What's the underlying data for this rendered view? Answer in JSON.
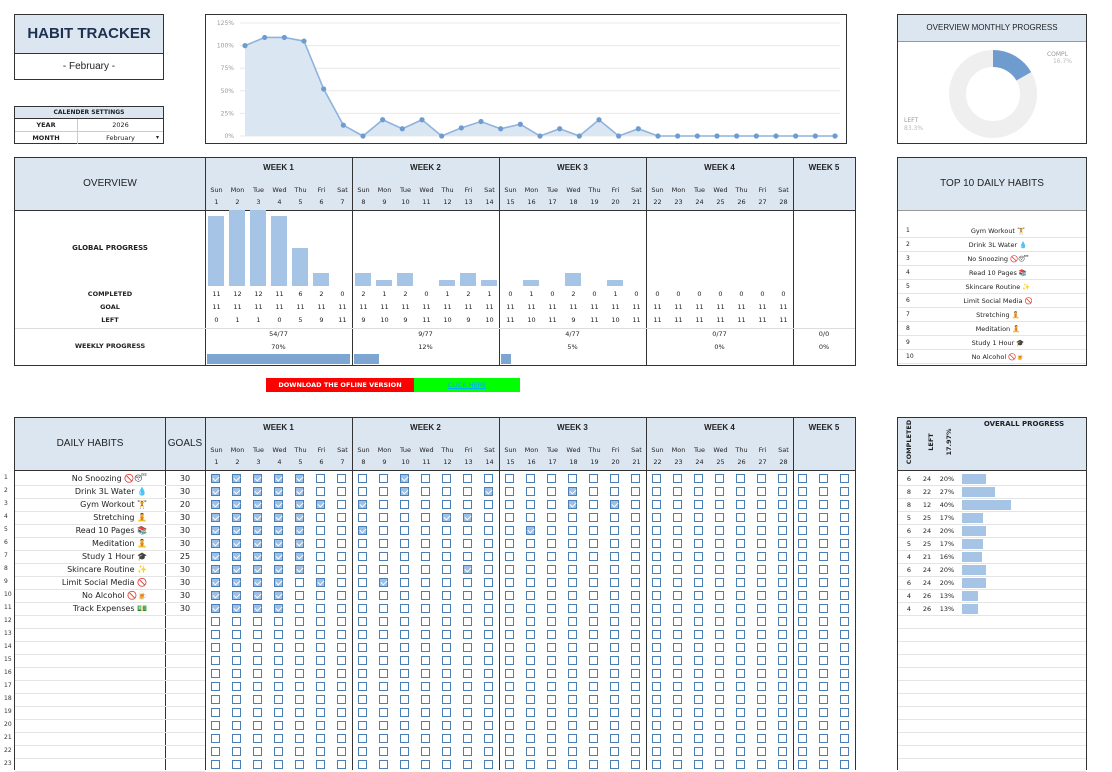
{
  "title": "HABIT TRACKER",
  "month_label": "- February -",
  "calendar": {
    "header": "CALENDER SETTINGS",
    "year_label": "YEAR",
    "year": "2026",
    "month_label": "MONTH",
    "month": "February"
  },
  "line_chart": {
    "y_ticks": [
      "125%",
      "100%",
      "75%",
      "50%",
      "25%",
      "0%"
    ],
    "values": [
      100,
      109,
      109,
      105,
      52,
      12,
      0,
      18,
      8,
      18,
      0,
      9,
      16,
      8,
      13,
      0,
      8,
      0,
      18,
      0,
      8,
      0,
      0,
      0,
      0,
      0,
      0,
      0,
      0,
      0,
      0
    ],
    "ylim": [
      0,
      125
    ]
  },
  "donut": {
    "title": "OVERVIEW MONTHLY PROGRESS",
    "compl_label": "COMPL",
    "compl_value": "16.7%",
    "left_label": "LEFT",
    "left_value": "83.3%",
    "compl_fraction": 0.167
  },
  "overview": {
    "title": "OVERVIEW",
    "global_progress_label": "GLOBAL PROGRESS",
    "completed_label": "COMPLETED",
    "goal_label": "GOAL",
    "left_label": "LEFT",
    "weekly_progress_label": "WEEKLY PROGRESS",
    "weeks": [
      "WEEK 1",
      "WEEK 2",
      "WEEK 3",
      "WEEK 4",
      "WEEK 5"
    ],
    "day_names": [
      "Sun",
      "Mon",
      "Tue",
      "Wed",
      "Thu",
      "Fri",
      "Sat"
    ],
    "completed": [
      11,
      12,
      12,
      11,
      6,
      2,
      0,
      1,
      2,
      0,
      1,
      2,
      1,
      0,
      1,
      0,
      2,
      0,
      1,
      0,
      0,
      0,
      0,
      0,
      0,
      0,
      0
    ],
    "goal": [
      11,
      11,
      11,
      11,
      11,
      11,
      11,
      11,
      11,
      11,
      11,
      11,
      11,
      11,
      11,
      11,
      11,
      11,
      11,
      11,
      11,
      11,
      11,
      11,
      11,
      11,
      11,
      11
    ],
    "left": [
      0,
      1,
      1,
      0,
      5,
      9,
      11,
      9,
      10,
      9,
      11,
      10,
      9,
      10,
      11,
      10,
      11,
      9,
      11,
      10,
      11,
      11,
      11,
      11,
      11,
      11,
      11,
      11
    ],
    "completed_full": [
      11,
      12,
      12,
      11,
      6,
      2,
      0,
      2,
      1,
      2,
      0,
      1,
      2,
      1,
      0,
      1,
      0,
      2,
      0,
      1,
      0,
      0,
      0,
      0,
      0,
      0,
      0,
      0
    ],
    "week_totals": [
      "54/77",
      "9/77",
      "4/77",
      "0/77",
      "0/0"
    ],
    "week_pct": [
      "70%",
      "12%",
      "5%",
      "0%",
      "0%"
    ],
    "week_pct_values": [
      70,
      12,
      5,
      0,
      0
    ]
  },
  "top10": {
    "title": "TOP 10 DAILY HABITS",
    "items": [
      "Gym Workout 🏋",
      "Drink 3L Water 💧",
      "No Snoozing 🚫😴",
      "Read 10 Pages 📚",
      "Skincare Routine ✨",
      "Limit Social Media 🚫",
      "Stretching 🧘",
      "Meditation 🧘",
      "Study 1 Hour 🎓",
      "No Alcohol 🚫🍺"
    ]
  },
  "cta": {
    "download": "DOWNLOAD THE OFLINE VERSION",
    "click": "CLICK HERE"
  },
  "daily": {
    "title": "DAILY HABITS",
    "goals_label": "GOALS",
    "habits": [
      {
        "name": "No Snoozing 🚫😴",
        "goal": 30
      },
      {
        "name": "Drink 3L Water 💧",
        "goal": 30
      },
      {
        "name": "Gym Workout 🏋",
        "goal": 20
      },
      {
        "name": "Stretching 🧘",
        "goal": 30
      },
      {
        "name": "Read 10 Pages 📚",
        "goal": 30
      },
      {
        "name": "Meditation 🧘",
        "goal": 30
      },
      {
        "name": "Study 1 Hour 🎓",
        "goal": 25
      },
      {
        "name": "Skincare Routine ✨",
        "goal": 30
      },
      {
        "name": "Limit Social Media 🚫",
        "goal": 30
      },
      {
        "name": "No Alcohol 🚫🍺",
        "goal": 30
      },
      {
        "name": "Track Expenses 💵",
        "goal": 30
      }
    ],
    "checks": [
      [
        1,
        1,
        1,
        1,
        1,
        0,
        0,
        0,
        0,
        1,
        0,
        0,
        0,
        0,
        0,
        0,
        0,
        0,
        0,
        0,
        0,
        0,
        0,
        0,
        0,
        0,
        0,
        0
      ],
      [
        1,
        1,
        1,
        1,
        1,
        0,
        0,
        0,
        0,
        1,
        0,
        0,
        0,
        1,
        0,
        0,
        0,
        1,
        0,
        0,
        0,
        0,
        0,
        0,
        0,
        0,
        0,
        0
      ],
      [
        1,
        1,
        1,
        1,
        1,
        1,
        0,
        1,
        0,
        0,
        0,
        0,
        0,
        0,
        0,
        0,
        0,
        1,
        0,
        1,
        0,
        0,
        0,
        0,
        0,
        0,
        0,
        0
      ],
      [
        1,
        1,
        1,
        1,
        1,
        0,
        0,
        0,
        0,
        0,
        0,
        1,
        1,
        0,
        0,
        0,
        0,
        0,
        0,
        0,
        0,
        0,
        0,
        0,
        0,
        0,
        0,
        0
      ],
      [
        1,
        1,
        1,
        1,
        1,
        0,
        0,
        1,
        0,
        0,
        0,
        0,
        0,
        0,
        0,
        1,
        0,
        0,
        0,
        0,
        0,
        0,
        0,
        0,
        0,
        0,
        0,
        0
      ],
      [
        1,
        1,
        1,
        1,
        1,
        0,
        0,
        0,
        0,
        0,
        0,
        0,
        0,
        0,
        0,
        0,
        0,
        0,
        0,
        0,
        0,
        0,
        0,
        0,
        0,
        0,
        0,
        0
      ],
      [
        1,
        1,
        1,
        1,
        1,
        0,
        0,
        0,
        0,
        0,
        0,
        0,
        0,
        0,
        0,
        0,
        0,
        0,
        0,
        0,
        0,
        0,
        0,
        0,
        0,
        0,
        0,
        0
      ],
      [
        1,
        1,
        1,
        1,
        1,
        0,
        0,
        0,
        0,
        0,
        0,
        0,
        1,
        0,
        0,
        0,
        0,
        0,
        0,
        0,
        0,
        0,
        0,
        0,
        0,
        0,
        0,
        0
      ],
      [
        1,
        1,
        1,
        1,
        0,
        1,
        0,
        0,
        1,
        0,
        0,
        0,
        0,
        0,
        0,
        0,
        0,
        0,
        0,
        0,
        0,
        0,
        0,
        0,
        0,
        0,
        0,
        0
      ],
      [
        1,
        1,
        1,
        1,
        0,
        0,
        0,
        0,
        0,
        0,
        0,
        0,
        0,
        0,
        0,
        0,
        0,
        0,
        0,
        0,
        0,
        0,
        0,
        0,
        0,
        0,
        0,
        0
      ],
      [
        1,
        1,
        1,
        1,
        0,
        0,
        0,
        0,
        0,
        0,
        0,
        0,
        0,
        0,
        0,
        0,
        0,
        0,
        0,
        0,
        0,
        0,
        0,
        0,
        0,
        0,
        0,
        0
      ]
    ]
  },
  "overall": {
    "title": "OVERALL PROGRESS",
    "completed_label": "COMPLETED",
    "left_label": "LEFT",
    "pct_label": "17.97%",
    "rows": [
      {
        "c": "6",
        "l": "24",
        "p": "20%",
        "v": 20
      },
      {
        "c": "8",
        "l": "22",
        "p": "27%",
        "v": 27
      },
      {
        "c": "8",
        "l": "12",
        "p": "40%",
        "v": 40
      },
      {
        "c": "5",
        "l": "25",
        "p": "17%",
        "v": 17
      },
      {
        "c": "6",
        "l": "24",
        "p": "20%",
        "v": 20
      },
      {
        "c": "5",
        "l": "25",
        "p": "17%",
        "v": 17
      },
      {
        "c": "4",
        "l": "21",
        "p": "16%",
        "v": 16
      },
      {
        "c": "6",
        "l": "24",
        "p": "20%",
        "v": 20
      },
      {
        "c": "6",
        "l": "24",
        "p": "20%",
        "v": 20
      },
      {
        "c": "4",
        "l": "26",
        "p": "13%",
        "v": 13
      },
      {
        "c": "4",
        "l": "26",
        "p": "13%",
        "v": 13
      }
    ]
  }
}
